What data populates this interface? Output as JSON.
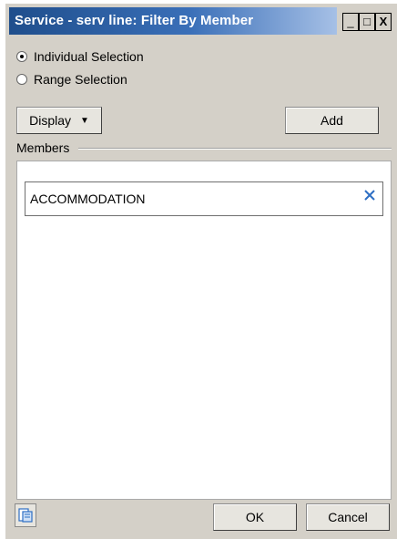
{
  "window": {
    "title": "Service - serv line: Filter By Member",
    "controls": {
      "minimize": "_",
      "maximize": "□",
      "close": "X"
    }
  },
  "selection_mode": {
    "options": [
      {
        "label": "Individual Selection",
        "selected": true
      },
      {
        "label": "Range Selection",
        "selected": false
      }
    ]
  },
  "toolbar": {
    "display_label": "Display",
    "display_caret": "▼",
    "add_label": "Add"
  },
  "members": {
    "group_label": "Members",
    "items": [
      {
        "label": "ACCOMMODATION"
      }
    ]
  },
  "footer": {
    "properties_icon": "properties-icon",
    "ok_label": "OK",
    "cancel_label": "Cancel"
  },
  "colors": {
    "titlebar_start": "#1f4e8c",
    "titlebar_end": "#a6c0e6",
    "dialog_bg": "#d4d0c8",
    "remove_icon": "#2e6fc4"
  }
}
